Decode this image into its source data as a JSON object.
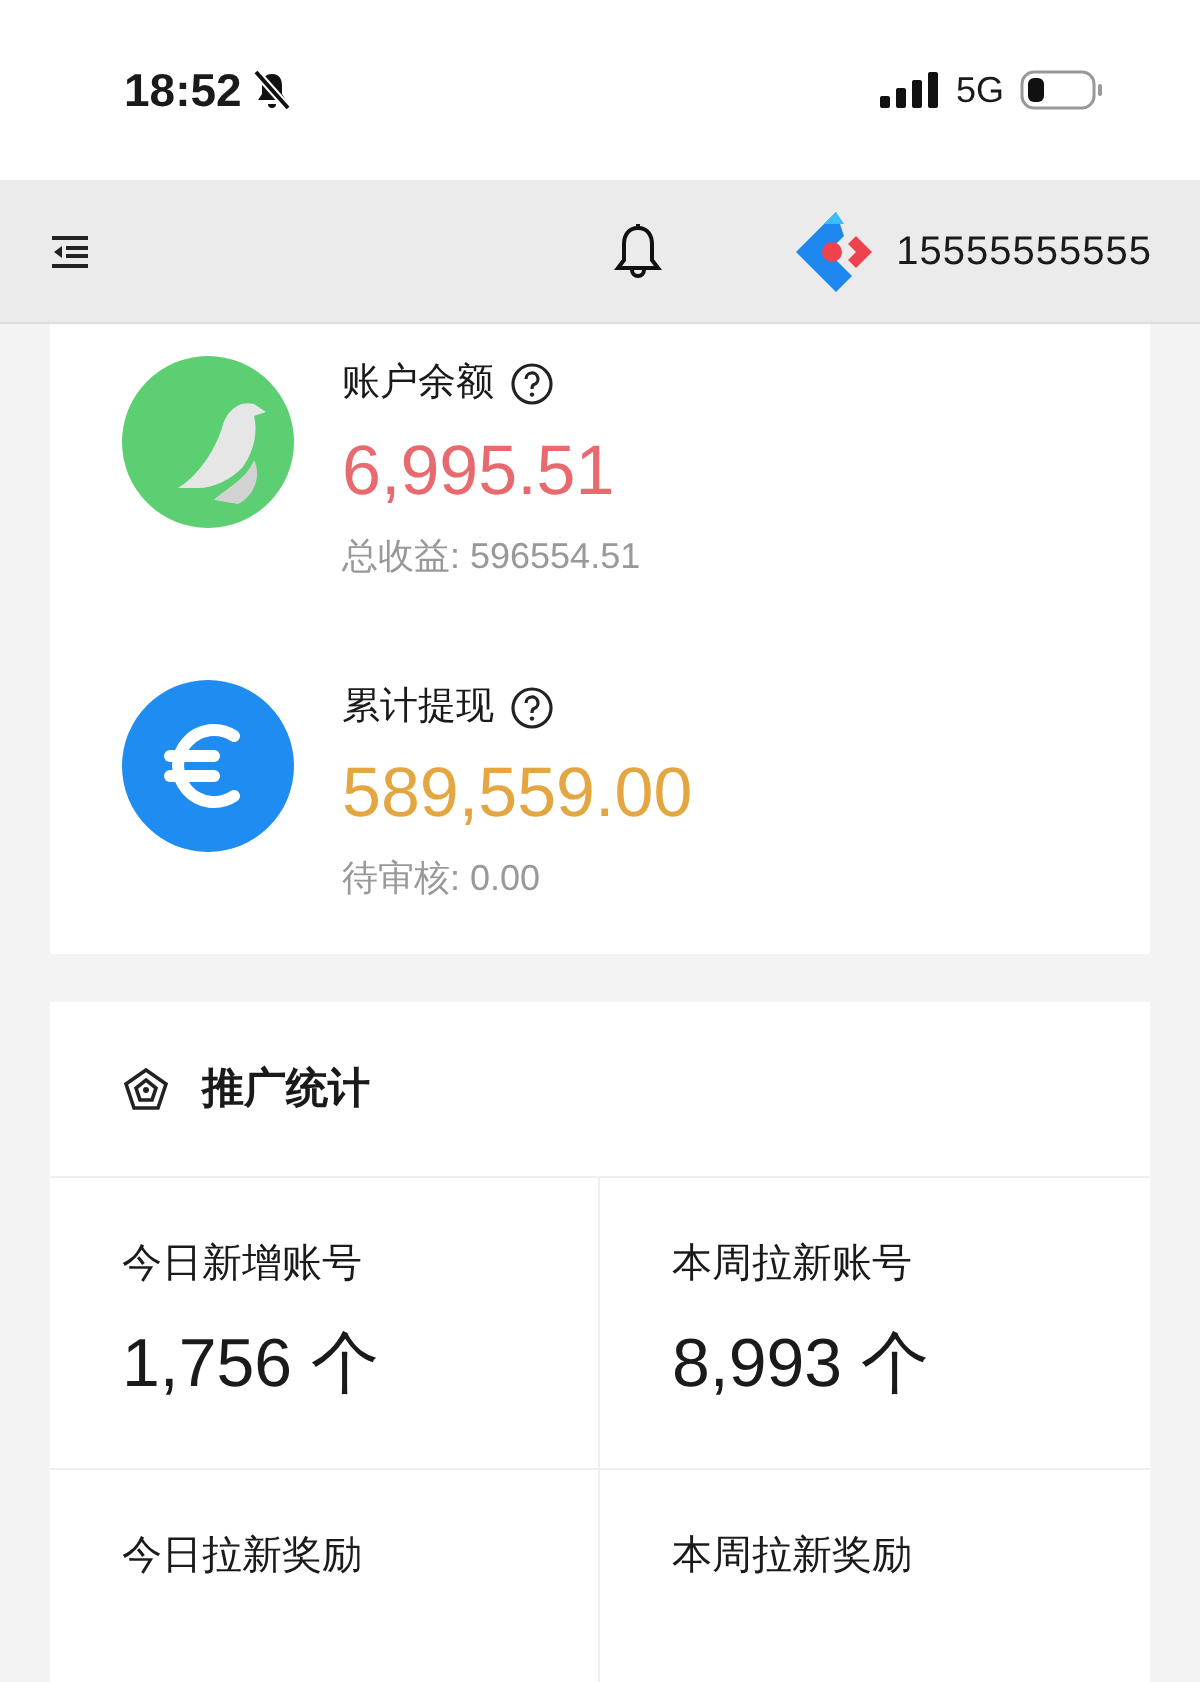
{
  "status_bar": {
    "time": "18:52",
    "network": "5G"
  },
  "header": {
    "user": "15555555555"
  },
  "balances": [
    {
      "kind": "bird",
      "label": "账户余额",
      "amount": "6,995.51",
      "color": "#e86a6e",
      "note": "总收益: 596554.51"
    },
    {
      "kind": "euro",
      "label": "累计提现",
      "amount": "589,559.00",
      "color": "#e3a640",
      "note": "待审核: 0.00"
    }
  ],
  "stats": {
    "title": "推广统计",
    "cells": [
      {
        "label": "今日新增账号",
        "value": "1,756 个"
      },
      {
        "label": "本周拉新账号",
        "value": "8,993 个"
      },
      {
        "label": "今日拉新奖励"
      },
      {
        "label": "本周拉新奖励"
      }
    ]
  }
}
